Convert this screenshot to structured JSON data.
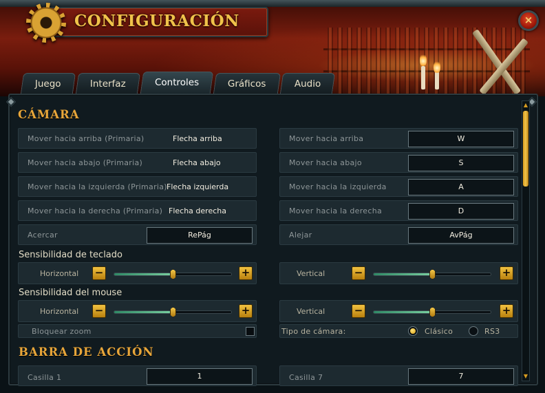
{
  "window": {
    "title": "CONFIGURACIÓN",
    "close_label": "×"
  },
  "tabs": [
    {
      "label": "Juego",
      "active": false
    },
    {
      "label": "Interfaz",
      "active": false
    },
    {
      "label": "Controles",
      "active": true
    },
    {
      "label": "Gráficos",
      "active": false
    },
    {
      "label": "Audio",
      "active": false
    }
  ],
  "camera": {
    "title": "CÁMARA",
    "primary": [
      {
        "label": "Mover hacia arriba (Primaria)",
        "key": "Flecha arriba"
      },
      {
        "label": "Mover hacia abajo (Primaria)",
        "key": "Flecha abajo"
      },
      {
        "label": "Mover hacia la izquierda (Primaria)",
        "key": "Flecha izquierda"
      },
      {
        "label": "Mover hacia la derecha (Primaria)",
        "key": "Flecha derecha"
      }
    ],
    "secondary": [
      {
        "label": "Mover hacia arriba",
        "key": "W"
      },
      {
        "label": "Mover hacia abajo",
        "key": "S"
      },
      {
        "label": "Mover hacia la izquierda",
        "key": "A"
      },
      {
        "label": "Mover hacia la derecha",
        "key": "D"
      }
    ],
    "zoom_in": {
      "label": "Acercar",
      "key": "RePág"
    },
    "zoom_out": {
      "label": "Alejar",
      "key": "AvPág"
    },
    "keyboard_sensitivity": {
      "title": "Sensibilidad de teclado",
      "horizontal_label": "Horizontal",
      "horizontal_value": 0.5,
      "vertical_label": "Vertical",
      "vertical_value": 0.5
    },
    "mouse_sensitivity": {
      "title": "Sensibilidad del mouse",
      "horizontal_label": "Horizontal",
      "horizontal_value": 0.5,
      "vertical_label": "Vertical",
      "vertical_value": 0.5
    },
    "lock_zoom_label": "Bloquear zoom",
    "lock_zoom_checked": false,
    "camera_type_label": "Tipo de cámara:",
    "camera_type_options": [
      "Clásico",
      "RS3"
    ],
    "camera_type_selected": "Clásico"
  },
  "action_bar": {
    "title": "BARRA DE ACCIÓN",
    "slots": [
      {
        "label": "Casilla 1",
        "key": "1"
      },
      {
        "label": "Casilla 7",
        "key": "7"
      }
    ]
  },
  "symbols": {
    "minus": "−",
    "plus": "+"
  },
  "colors": {
    "accent": "#e8a63a",
    "title": "#f0c24a",
    "button": "#f2c240",
    "slider_fill": "#2f8a66"
  }
}
